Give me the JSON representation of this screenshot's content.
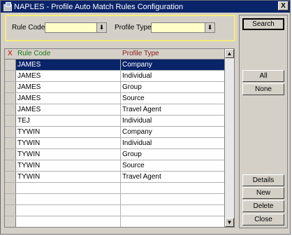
{
  "window": {
    "title": "NAPLES - Profile Auto Match Rules Configuration",
    "close_glyph": "X"
  },
  "filter": {
    "rule_code_label": "Rule Code",
    "rule_code_value": "",
    "profile_type_label": "Profile Type",
    "profile_type_value": ""
  },
  "grid": {
    "col_x": "X",
    "col_rule_code": "Rule Code",
    "col_profile_type": "Profile Type",
    "rows": [
      {
        "rule_code": "JAMES",
        "profile_type": "Company"
      },
      {
        "rule_code": "JAMES",
        "profile_type": "Individual"
      },
      {
        "rule_code": "JAMES",
        "profile_type": "Group"
      },
      {
        "rule_code": "JAMES",
        "profile_type": "Source"
      },
      {
        "rule_code": "JAMES",
        "profile_type": "Travel Agent"
      },
      {
        "rule_code": "TEJ",
        "profile_type": "Individual"
      },
      {
        "rule_code": "TYWIN",
        "profile_type": "Company"
      },
      {
        "rule_code": "TYWIN",
        "profile_type": "Individual"
      },
      {
        "rule_code": "TYWIN",
        "profile_type": "Group"
      },
      {
        "rule_code": "TYWIN",
        "profile_type": "Source"
      },
      {
        "rule_code": "TYWIN",
        "profile_type": "Travel Agent"
      }
    ],
    "selected_row": 0
  },
  "buttons": {
    "search": "Search",
    "all": "All",
    "none": "None",
    "details": "Details",
    "new": "New",
    "delete": "Delete",
    "close": "Close"
  },
  "colors": {
    "title_bar": "#0a246a",
    "selection": "#0a246a",
    "filter_field": "#fffec8",
    "filter_border": "#f4ed7c",
    "rule_code_header": "#1a7a1a",
    "profile_type_header": "#8b1a1a",
    "x_header": "#c00000"
  }
}
